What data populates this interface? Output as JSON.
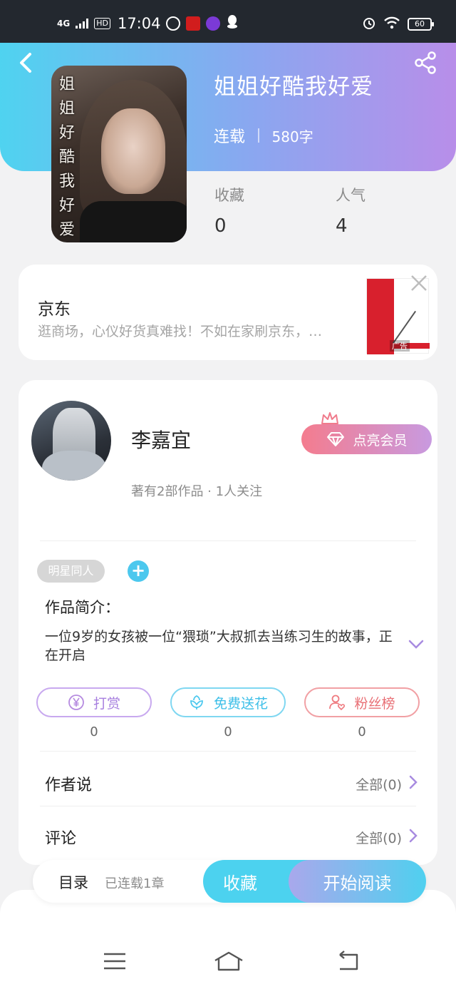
{
  "status_bar": {
    "network": "4G",
    "hd": "HD",
    "time": "17:04",
    "battery": "60"
  },
  "book": {
    "title": "姐姐好酷我好爱",
    "status": "连载",
    "word_count": "580字",
    "cover_text": "姐姐好酷我好爱",
    "stats": [
      {
        "label": "收藏",
        "value": "0"
      },
      {
        "label": "人气",
        "value": "4"
      }
    ]
  },
  "ad": {
    "title": "京东",
    "description": "逛商场，心仪好货真难找！不如在家刷京东，…",
    "thumb_tag": "广告"
  },
  "author": {
    "name": "李嘉宜",
    "meta": "著有2部作品 · 1人关注",
    "vip_label": "点亮会员"
  },
  "tags": [
    "明星同人"
  ],
  "intro": {
    "heading": "作品简介：",
    "text": "一位9岁的女孩被一位“猥琐”大叔抓去当练习生的故事，正在开启"
  },
  "actions": [
    {
      "label": "打赏",
      "count": "0",
      "color": "#b68be0",
      "icon": "yen-icon"
    },
    {
      "label": "免费送花",
      "count": "0",
      "color": "#4cc8ee",
      "icon": "flower-icon"
    },
    {
      "label": "粉丝榜",
      "count": "0",
      "color": "#ef7b80",
      "icon": "fans-icon"
    }
  ],
  "rows": [
    {
      "label": "作者说",
      "right": "全部(0)"
    },
    {
      "label": "评论",
      "right": "全部(0)"
    }
  ],
  "bottom_bar": {
    "toc": "目录",
    "toc_sub": "已连载1章",
    "favorite": "收藏",
    "read": "开始阅读"
  },
  "colors": {
    "accent_cyan": "#4cd2ef",
    "accent_purple": "#b88ee9",
    "vip_pink": "#f47c8e"
  }
}
